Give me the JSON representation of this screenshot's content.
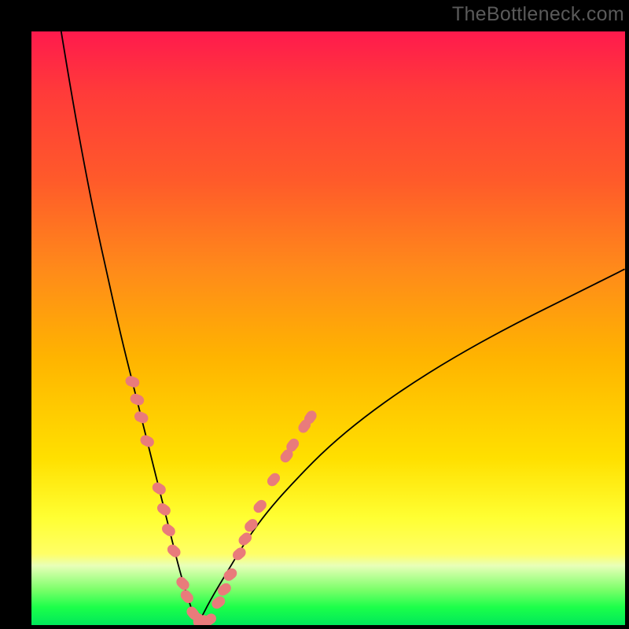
{
  "watermark": "TheBottleneck.com",
  "colors": {
    "dot": "#e97b7b",
    "curve": "#000000"
  },
  "chart_data": {
    "type": "line",
    "title": "",
    "xlabel": "",
    "ylabel": "",
    "xlim": [
      0,
      100
    ],
    "ylim": [
      0,
      100
    ],
    "grid": false,
    "legend": false,
    "series": [
      {
        "name": "bottleneck-curve",
        "x": [
          5,
          7,
          9,
          11,
          13,
          15,
          17,
          19,
          20.5,
          22,
          23.5,
          25,
          26.5,
          28,
          30,
          33,
          36,
          40,
          45,
          50,
          56,
          63,
          71,
          80,
          90,
          100
        ],
        "y": [
          100,
          88,
          77,
          67,
          58,
          49,
          41,
          33,
          27,
          21,
          15,
          9,
          4,
          0,
          4,
          9,
          14,
          19.5,
          25,
          30,
          35,
          40,
          45,
          50,
          55,
          60
        ]
      }
    ],
    "data_points": {
      "name": "sample-dots",
      "points": [
        {
          "x_pct": 17.0,
          "y_pct": 41.0
        },
        {
          "x_pct": 17.8,
          "y_pct": 38.0
        },
        {
          "x_pct": 18.5,
          "y_pct": 35.0
        },
        {
          "x_pct": 19.5,
          "y_pct": 31.0
        },
        {
          "x_pct": 21.5,
          "y_pct": 23.0
        },
        {
          "x_pct": 22.3,
          "y_pct": 19.5
        },
        {
          "x_pct": 23.1,
          "y_pct": 16.0
        },
        {
          "x_pct": 24.0,
          "y_pct": 12.5
        },
        {
          "x_pct": 25.5,
          "y_pct": 7.0
        },
        {
          "x_pct": 26.2,
          "y_pct": 4.8
        },
        {
          "x_pct": 27.2,
          "y_pct": 2.0
        },
        {
          "x_pct": 28.1,
          "y_pct": 0.8
        },
        {
          "x_pct": 29.0,
          "y_pct": 0.5
        },
        {
          "x_pct": 30.0,
          "y_pct": 0.9
        },
        {
          "x_pct": 31.5,
          "y_pct": 3.8
        },
        {
          "x_pct": 32.5,
          "y_pct": 6.0
        },
        {
          "x_pct": 33.5,
          "y_pct": 8.5
        },
        {
          "x_pct": 35.0,
          "y_pct": 12.0
        },
        {
          "x_pct": 36.0,
          "y_pct": 14.5
        },
        {
          "x_pct": 37.0,
          "y_pct": 16.8
        },
        {
          "x_pct": 38.5,
          "y_pct": 20.0
        },
        {
          "x_pct": 40.8,
          "y_pct": 24.5
        },
        {
          "x_pct": 43.0,
          "y_pct": 28.5
        },
        {
          "x_pct": 44.0,
          "y_pct": 30.3
        },
        {
          "x_pct": 46.0,
          "y_pct": 33.5
        },
        {
          "x_pct": 47.0,
          "y_pct": 35.0
        }
      ]
    }
  }
}
